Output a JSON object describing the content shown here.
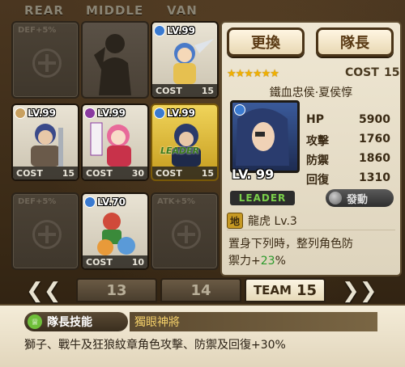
{
  "columns": {
    "rear": "REAR",
    "middle": "MIDDLE",
    "van": "VAN"
  },
  "slots": [
    {
      "kind": "empty",
      "boost": "DEF+5%"
    },
    {
      "kind": "silhouette"
    },
    {
      "kind": "char",
      "level": "LV.99",
      "cost_label": "COST",
      "cost": "15",
      "icon_color": "#3a7ad0",
      "art_color": "#4a7ac8"
    },
    {
      "kind": "char",
      "level": "LV.99",
      "cost_label": "COST",
      "cost": "15",
      "icon_color": "#c8a060",
      "art_color": "#3a4a8a"
    },
    {
      "kind": "char",
      "level": "LV.99",
      "cost_label": "COST",
      "cost": "30",
      "icon_color": "#8a3aa0",
      "art_color": "#e86a9a"
    },
    {
      "kind": "char",
      "level": "LV.99",
      "cost_label": "COST",
      "cost": "15",
      "icon_color": "#3a7ad0",
      "art_color": "#2a3a6a",
      "leader": "LEADER"
    },
    {
      "kind": "empty",
      "boost": "DEF+5%"
    },
    {
      "kind": "char",
      "level": "LV.70",
      "cost_label": "COST",
      "cost": "10",
      "icon_color": "#3a7ad0",
      "art_color": "#d04a3a"
    },
    {
      "kind": "empty",
      "boost": "ATK+5%"
    }
  ],
  "panel": {
    "change_label": "更換",
    "captain_label": "隊長",
    "stars": "★★★★★★",
    "cost_label": "COST",
    "cost": "15",
    "name": "鐵血忠侯·夏侯惇",
    "level": "LV. 99",
    "stats": [
      {
        "label": "HP",
        "value": "5900"
      },
      {
        "label": "攻擊",
        "value": "1760"
      },
      {
        "label": "防禦",
        "value": "1860"
      },
      {
        "label": "回復",
        "value": "1310"
      }
    ],
    "leader_badge": "LEADER",
    "activate_label": "發動",
    "skill_icon": "地",
    "skill_name": "龍虎 Lv.3",
    "desc_line1": "置身下列時，整列角色防",
    "desc_line2_a": "禦力+",
    "desc_line2_pct": "23",
    "desc_line2_b": "%"
  },
  "team_nav": {
    "tab1": "13",
    "tab2": "14",
    "active_prefix": "TEAM",
    "active_num": "15"
  },
  "leader_skill": {
    "button_label": "隊長技能",
    "name": "獨眼神將",
    "description": "獅子、戰牛及狂狼紋章角色攻擊、防禦及回復+30%"
  }
}
